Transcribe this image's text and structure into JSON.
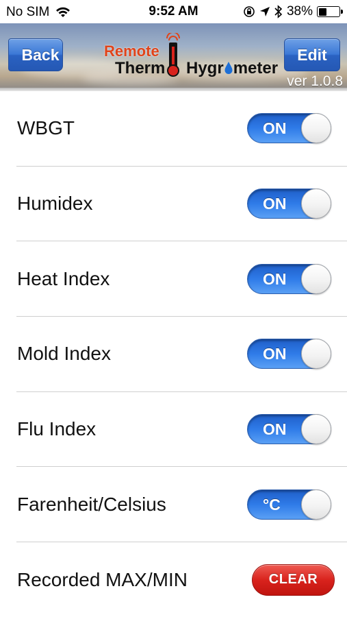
{
  "status_bar": {
    "carrier": "No SIM",
    "time": "9:52 AM",
    "battery_percent": "38%",
    "battery_level": 0.38,
    "icons": [
      "wifi-icon",
      "orientation-lock-icon",
      "location-arrow-icon",
      "bluetooth-icon",
      "battery-icon"
    ]
  },
  "nav": {
    "back_label": "Back",
    "edit_label": "Edit",
    "logo": {
      "remote": "Remote",
      "thermo": "Therm",
      "hygro": "Hygr",
      "hygro_tail": "meter"
    },
    "version": "ver 1.0.8"
  },
  "settings": [
    {
      "label": "WBGT",
      "control": "toggle",
      "value": "ON"
    },
    {
      "label": "Humidex",
      "control": "toggle",
      "value": "ON"
    },
    {
      "label": "Heat Index",
      "control": "toggle",
      "value": "ON"
    },
    {
      "label": "Mold Index",
      "control": "toggle",
      "value": "ON"
    },
    {
      "label": "Flu Index",
      "control": "toggle",
      "value": "ON"
    },
    {
      "label": "Farenheit/Celsius",
      "control": "toggle",
      "value": "°C"
    },
    {
      "label": "Recorded MAX/MIN",
      "control": "button",
      "value": "CLEAR"
    }
  ],
  "colors": {
    "toggle_on": "#2f7be8",
    "clear_button": "#d9231d",
    "nav_button": "#3b78d6",
    "logo_red": "#e0441a"
  }
}
